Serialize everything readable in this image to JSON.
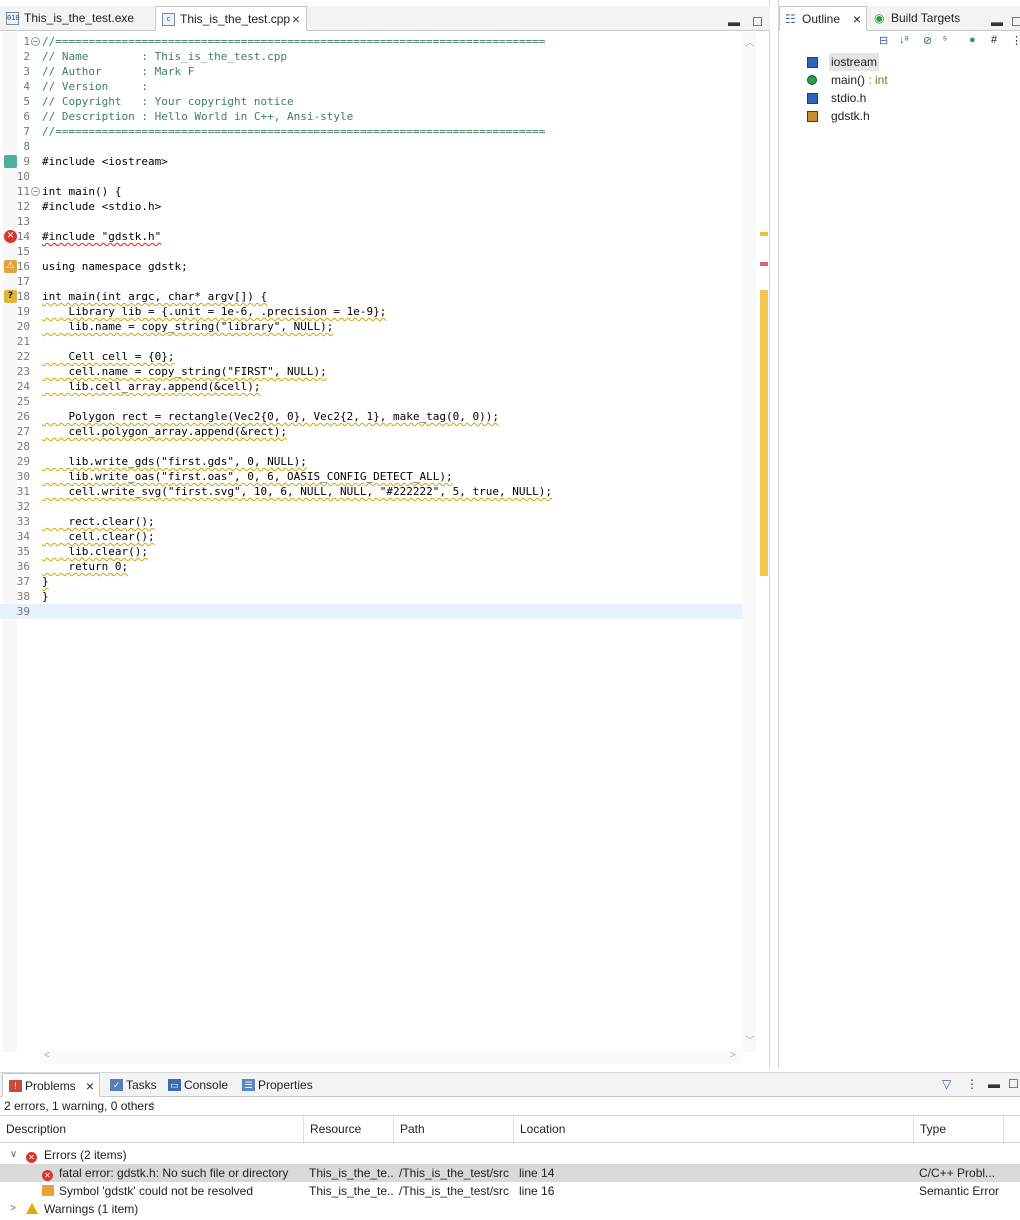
{
  "editor": {
    "tabs": [
      {
        "label": "This_is_the_test.exe",
        "icon": "binary-file-icon"
      },
      {
        "label": "This_is_the_test.cpp",
        "icon": "cpp-file-icon",
        "active": true
      }
    ],
    "lines": [
      {
        "n": "1",
        "text": "//==========================================================================",
        "kind": "comment",
        "fold": "⊖"
      },
      {
        "n": "2",
        "text": "// Name        : This_is_the_test.cpp",
        "kind": "comment"
      },
      {
        "n": "3",
        "text": "// Author      : Mark F",
        "kind": "comment"
      },
      {
        "n": "4",
        "text": "// Version     :",
        "kind": "comment"
      },
      {
        "n": "5",
        "text": "// Copyright   : Your copyright notice",
        "kind": "comment"
      },
      {
        "n": "6",
        "text": "// Description : Hello World in C++, Ansi-style",
        "kind": "comment"
      },
      {
        "n": "7",
        "text": "//==========================================================================",
        "kind": "comment"
      },
      {
        "n": "8",
        "text": ""
      },
      {
        "n": "9",
        "text": "#include <iostream>",
        "kind": "include",
        "marker": "bp"
      },
      {
        "n": "10",
        "text": ""
      },
      {
        "n": "11",
        "text": "int main() {",
        "kind": "code",
        "fold": "⊖"
      },
      {
        "n": "12",
        "text": "#include <stdio.h>",
        "kind": "include"
      },
      {
        "n": "13",
        "text": ""
      },
      {
        "n": "14",
        "text": "#include \"gdstk.h\"",
        "kind": "include",
        "marker": "error",
        "underline": "err"
      },
      {
        "n": "15",
        "text": ""
      },
      {
        "n": "16",
        "text": "using namespace gdstk;",
        "kind": "code",
        "marker": "sem"
      },
      {
        "n": "17",
        "text": ""
      },
      {
        "n": "18",
        "text": "int main(int argc, char* argv[]) {",
        "kind": "code",
        "marker": "warn",
        "underline": "warn"
      },
      {
        "n": "19",
        "text": "    Library lib = {.unit = 1e-6, .precision = 1e-9};",
        "kind": "code",
        "underline": "warn"
      },
      {
        "n": "20",
        "text": "    lib.name = copy_string(\"library\", NULL);",
        "kind": "code",
        "underline": "warn"
      },
      {
        "n": "21",
        "text": ""
      },
      {
        "n": "22",
        "text": "    Cell cell = {0};",
        "kind": "code",
        "underline": "warn"
      },
      {
        "n": "23",
        "text": "    cell.name = copy_string(\"FIRST\", NULL);",
        "kind": "code",
        "underline": "warn"
      },
      {
        "n": "24",
        "text": "    lib.cell_array.append(&cell);",
        "kind": "code",
        "underline": "warn"
      },
      {
        "n": "25",
        "text": ""
      },
      {
        "n": "26",
        "text": "    Polygon rect = rectangle(Vec2{0, 0}, Vec2{2, 1}, make_tag(0, 0));",
        "kind": "code",
        "underline": "warn"
      },
      {
        "n": "27",
        "text": "    cell.polygon_array.append(&rect);",
        "kind": "code",
        "underline": "warn"
      },
      {
        "n": "28",
        "text": ""
      },
      {
        "n": "29",
        "text": "    lib.write_gds(\"first.gds\", 0, NULL);",
        "kind": "code",
        "underline": "warn"
      },
      {
        "n": "30",
        "text": "    lib.write_oas(\"first.oas\", 0, 6, OASIS_CONFIG_DETECT_ALL);",
        "kind": "code",
        "underline": "warn"
      },
      {
        "n": "31",
        "text": "    cell.write_svg(\"first.svg\", 10, 6, NULL, NULL, \"#222222\", 5, true, NULL);",
        "kind": "code",
        "underline": "warn"
      },
      {
        "n": "32",
        "text": ""
      },
      {
        "n": "33",
        "text": "    rect.clear();",
        "kind": "code",
        "underline": "warn"
      },
      {
        "n": "34",
        "text": "    cell.clear();",
        "kind": "code",
        "underline": "warn"
      },
      {
        "n": "35",
        "text": "    lib.clear();",
        "kind": "code",
        "underline": "warn"
      },
      {
        "n": "36",
        "text": "    return 0;",
        "kind": "code",
        "underline": "warn"
      },
      {
        "n": "37",
        "text": "}",
        "kind": "code",
        "underline": "warn"
      },
      {
        "n": "38",
        "text": "}",
        "kind": "code"
      },
      {
        "n": "39",
        "text": "",
        "current": true
      }
    ]
  },
  "outline": {
    "tabs": [
      {
        "label": "Outline",
        "icon": "outline-icon",
        "active": true
      },
      {
        "label": "Build Targets",
        "icon": "build-targets-icon"
      }
    ],
    "items": [
      {
        "label": "iostream",
        "type": "",
        "icon": "include-icon",
        "selected": true
      },
      {
        "label": "main()",
        "type": " : int",
        "icon": "function-icon"
      },
      {
        "label": "stdio.h",
        "type": "",
        "icon": "include-icon"
      },
      {
        "label": "gdstk.h",
        "type": "",
        "icon": "include-warning-icon"
      }
    ]
  },
  "problems": {
    "tabs": [
      {
        "label": "Problems",
        "icon": "problems-icon",
        "active": true
      },
      {
        "label": "Tasks",
        "icon": "tasks-icon"
      },
      {
        "label": "Console",
        "icon": "console-icon"
      },
      {
        "label": "Properties",
        "icon": "properties-icon"
      }
    ],
    "summary": "2 errors, 1 warning, 0 others",
    "columns": [
      "Description",
      "Resource",
      "Path",
      "Location",
      "Type"
    ],
    "groups": [
      {
        "label": "Errors (2 items)",
        "icon": "error-icon",
        "expanded": true
      },
      {
        "label": "Warnings (1 item)",
        "icon": "warning-icon",
        "expanded": false
      }
    ],
    "rows": [
      {
        "description": "fatal error: gdstk.h: No such file or directory",
        "resource": "This_is_the_te...",
        "path": "/This_is_the_test/src",
        "location": "line 14",
        "type": "C/C++ Probl...",
        "icon": "error-icon",
        "selected": true
      },
      {
        "description": "Symbol 'gdstk' could not be resolved",
        "resource": "This_is_the_te...",
        "path": "/This_is_the_test/src",
        "location": "line 16",
        "type": "Semantic Error",
        "icon": "semantic-error-icon"
      }
    ]
  }
}
